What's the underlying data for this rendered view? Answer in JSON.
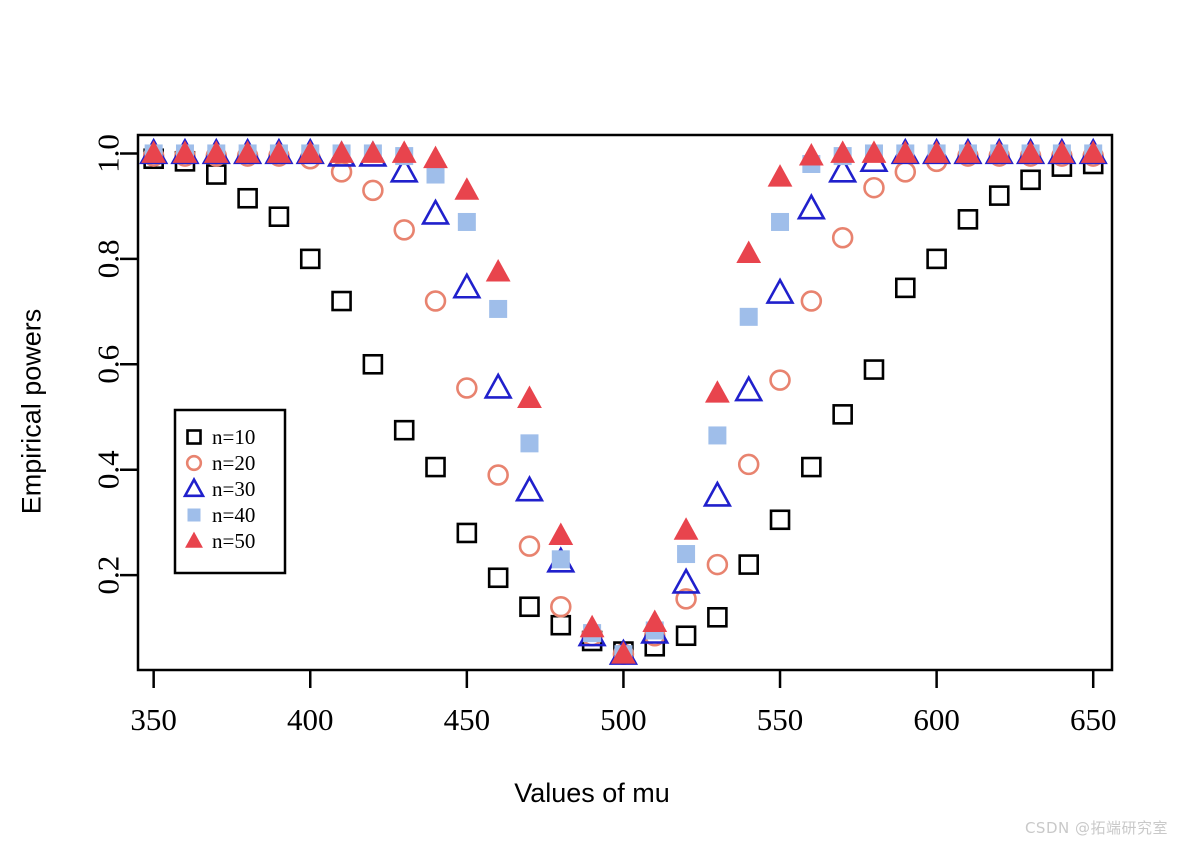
{
  "figure": {
    "watermark": "CSDN @拓端研究室",
    "background": "#ffffff"
  },
  "chart_data": {
    "type": "scatter",
    "title": "",
    "xlabel": "Values of mu",
    "ylabel": "Empirical powers",
    "xlim": [
      345,
      656
    ],
    "ylim": [
      0.02,
      1.035
    ],
    "grid": false,
    "legend_position": "left-middle",
    "xticks": [
      350,
      400,
      450,
      500,
      550,
      600,
      650
    ],
    "yticks": [
      0.2,
      0.4,
      0.6,
      0.8,
      1.0
    ],
    "xtick_labels": [
      "350",
      "400",
      "450",
      "500",
      "550",
      "600",
      "650"
    ],
    "ytick_labels": [
      "0.2",
      "0.4",
      "0.6",
      "0.8",
      "1.0"
    ],
    "x": [
      350,
      360,
      370,
      380,
      390,
      400,
      410,
      420,
      430,
      440,
      450,
      460,
      470,
      480,
      490,
      500,
      510,
      520,
      530,
      540,
      550,
      560,
      570,
      580,
      590,
      600,
      610,
      620,
      630,
      640,
      650
    ],
    "series": [
      {
        "name": "n=10",
        "marker": "open-square",
        "color": "#000000",
        "values": [
          0.99,
          0.985,
          0.96,
          0.915,
          0.88,
          0.8,
          0.72,
          0.6,
          0.475,
          0.405,
          0.28,
          0.195,
          0.14,
          0.105,
          0.075,
          0.055,
          0.065,
          0.085,
          0.12,
          0.22,
          0.305,
          0.405,
          0.505,
          0.59,
          0.745,
          0.8,
          0.875,
          0.92,
          0.95,
          0.975,
          0.98
        ]
      },
      {
        "name": "n=20",
        "marker": "open-circle",
        "color": "#E8836F",
        "values": [
          0.995,
          0.995,
          0.995,
          0.995,
          0.995,
          0.99,
          0.965,
          0.93,
          0.855,
          0.72,
          0.555,
          0.39,
          0.255,
          0.14,
          0.085,
          0.05,
          0.085,
          0.155,
          0.22,
          0.41,
          0.57,
          0.72,
          0.84,
          0.935,
          0.965,
          0.985,
          0.995,
          0.995,
          0.995,
          0.995,
          0.995
        ]
      },
      {
        "name": "n=30",
        "marker": "open-triangle",
        "color": "#2020CC",
        "values": [
          1.0,
          1.0,
          1.0,
          1.0,
          1.0,
          1.0,
          0.995,
          0.995,
          0.965,
          0.885,
          0.745,
          0.555,
          0.36,
          0.225,
          0.085,
          0.05,
          0.09,
          0.185,
          0.35,
          0.55,
          0.735,
          0.895,
          0.965,
          0.985,
          1.0,
          1.0,
          1.0,
          1.0,
          1.0,
          1.0,
          1.0
        ]
      },
      {
        "name": "n=40",
        "marker": "filled-square",
        "color": "#9FBEEA",
        "values": [
          1.0,
          1.0,
          1.0,
          1.0,
          1.0,
          1.0,
          1.0,
          1.0,
          0.995,
          0.96,
          0.87,
          0.705,
          0.45,
          0.23,
          0.09,
          0.05,
          0.095,
          0.24,
          0.465,
          0.69,
          0.87,
          0.98,
          0.995,
          1.0,
          1.0,
          1.0,
          1.0,
          1.0,
          1.0,
          1.0,
          1.0
        ]
      },
      {
        "name": "n=50",
        "marker": "filled-triangle",
        "color": "#E8444D",
        "values": [
          1.0,
          1.0,
          1.0,
          1.0,
          1.0,
          1.0,
          1.0,
          1.0,
          1.0,
          0.99,
          0.93,
          0.775,
          0.535,
          0.275,
          0.1,
          0.05,
          0.11,
          0.285,
          0.545,
          0.81,
          0.955,
          0.995,
          1.0,
          1.0,
          1.0,
          1.0,
          1.0,
          1.0,
          1.0,
          1.0,
          1.0
        ]
      }
    ],
    "legend": [
      {
        "label": "n=10",
        "marker": "open-square",
        "color": "#000000"
      },
      {
        "label": "n=20",
        "marker": "open-circle",
        "color": "#E8836F"
      },
      {
        "label": "n=30",
        "marker": "open-triangle",
        "color": "#2020CC"
      },
      {
        "label": "n=40",
        "marker": "filled-square",
        "color": "#9FBEEA"
      },
      {
        "label": "n=50",
        "marker": "filled-triangle",
        "color": "#E8444D"
      }
    ]
  }
}
